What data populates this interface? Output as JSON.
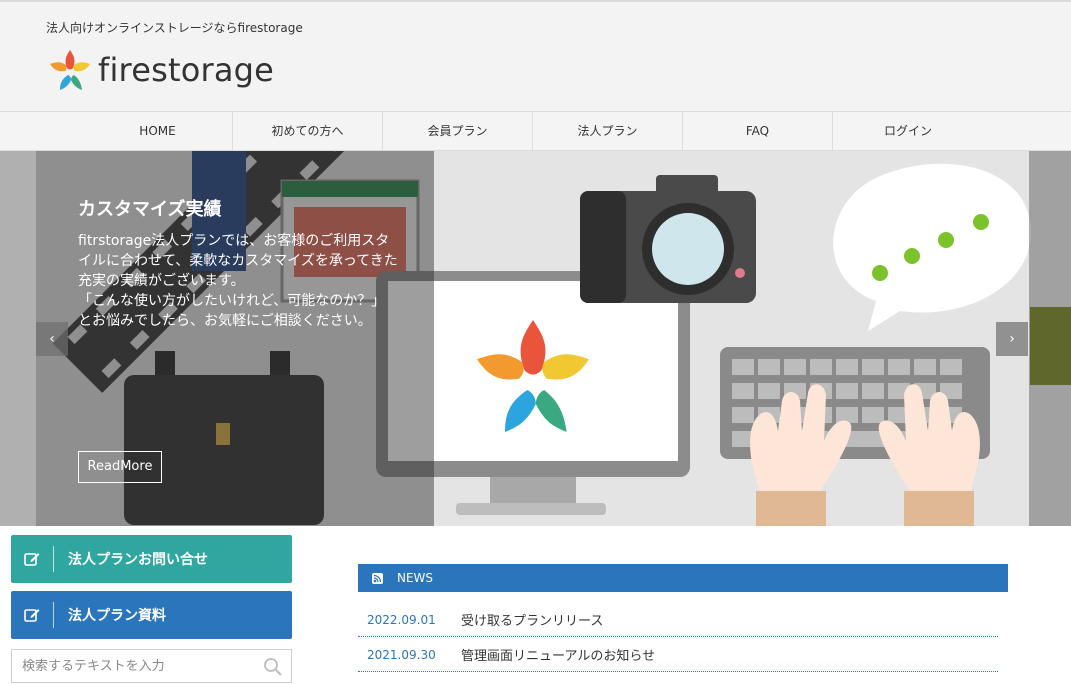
{
  "header": {
    "tagline": "法人向けオンラインストレージならfirestorage",
    "logo_text": "firestorage"
  },
  "nav": {
    "items": [
      "HOME",
      "初めての方へ",
      "会員プラン",
      "法人プラン",
      "FAQ",
      "ログイン"
    ]
  },
  "hero": {
    "title": "カスタマイズ実績",
    "body": "fitrstorage法人プランでは、お客様のご利用スタイルに合わせて、柔軟なカスタマイズを承ってきた充実の実績がございます。\n「こんな使い方がしたいけれど、可能なのか？」\nとお悩みでしたら、お気軽にご相談ください。",
    "button": "ReadMore",
    "prev_arrow": "‹",
    "next_arrow": "›"
  },
  "sidebar": {
    "contact_label": "法人プランお問い合せ",
    "docs_label": "法人プラン資料",
    "search_placeholder": "検索するテキストを入力"
  },
  "news": {
    "heading": "NEWS",
    "items": [
      {
        "date": "2022.09.01",
        "title": "受け取るプランリリース"
      },
      {
        "date": "2021.09.30",
        "title": "管理画面リニューアルのお知らせ"
      }
    ]
  },
  "colors": {
    "teal": "#2fa6a0",
    "blue": "#2a75bc"
  }
}
